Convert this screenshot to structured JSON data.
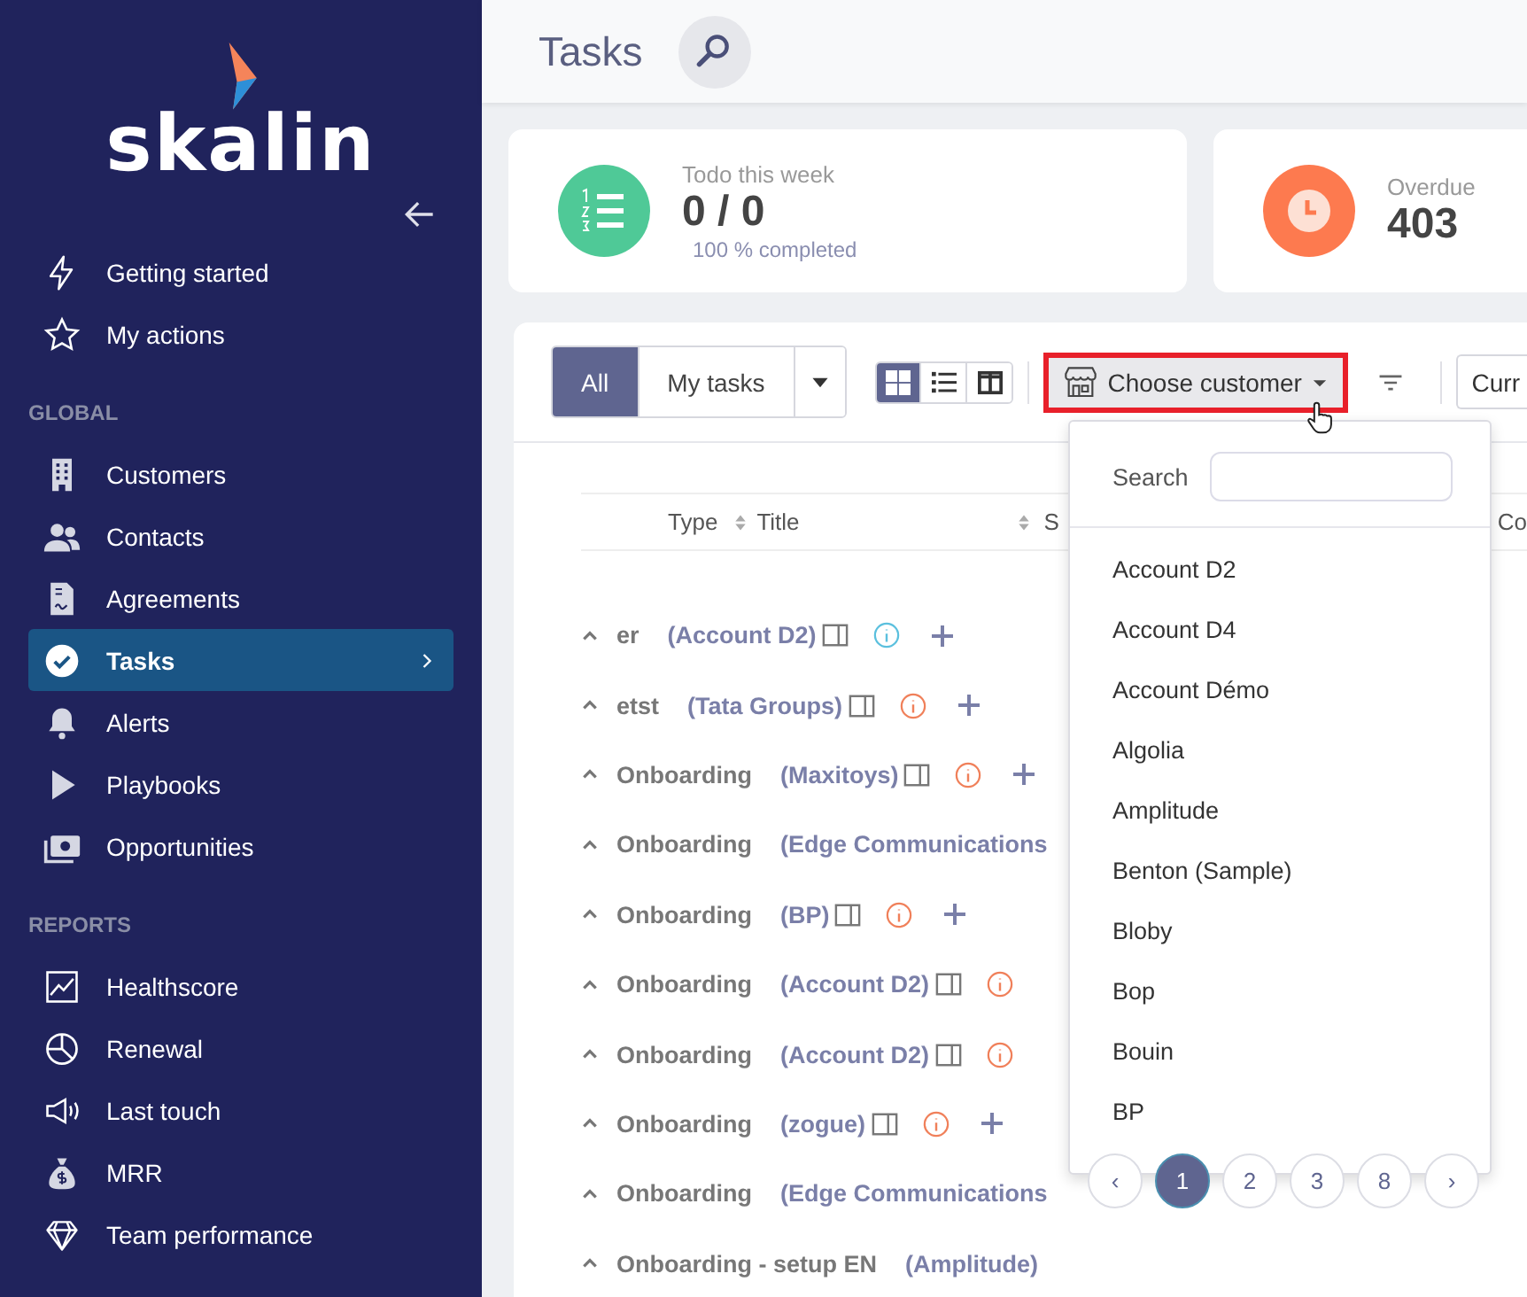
{
  "sidebar": {
    "logo": "skalin",
    "top_items": [
      {
        "label": "Getting started",
        "selected": false
      },
      {
        "label": "My actions",
        "selected": false
      }
    ],
    "sections": [
      {
        "title": "GLOBAL",
        "items": [
          {
            "label": "Customers",
            "selected": false
          },
          {
            "label": "Contacts",
            "selected": false
          },
          {
            "label": "Agreements",
            "selected": false
          },
          {
            "label": "Tasks",
            "selected": true
          },
          {
            "label": "Alerts",
            "selected": false
          },
          {
            "label": "Playbooks",
            "selected": false
          },
          {
            "label": "Opportunities",
            "selected": false
          }
        ]
      },
      {
        "title": "REPORTS",
        "items": [
          {
            "label": "Healthscore",
            "selected": false
          },
          {
            "label": "Renewal",
            "selected": false
          },
          {
            "label": "Last touch",
            "selected": false
          },
          {
            "label": "MRR",
            "selected": false
          },
          {
            "label": "Team performance",
            "selected": false
          }
        ]
      }
    ]
  },
  "header": {
    "title": "Tasks"
  },
  "stats": [
    {
      "kind": "todo",
      "label": "Todo this week",
      "value": "0 / 0",
      "sub": "100 % completed"
    },
    {
      "kind": "overdue",
      "label": "Overdue",
      "value": "403"
    }
  ],
  "toolbar": {
    "scope_tabs": [
      {
        "label": "All",
        "selected": true
      },
      {
        "label": "My tasks",
        "selected": false
      }
    ],
    "views": [
      {
        "kind": "grid",
        "selected": true
      },
      {
        "kind": "list",
        "selected": false
      },
      {
        "kind": "columns",
        "selected": false
      }
    ],
    "customer_button": "Choose customer",
    "period_button": "Curr"
  },
  "table": {
    "columns": [
      "Type",
      "Title",
      "S",
      "Co"
    ],
    "rows": [
      {
        "title": "er",
        "customer": "(Account D2)",
        "color": "#5bc0de",
        "add": true
      },
      {
        "title": "etst",
        "customer": "(Tata Groups)",
        "color": "#f0805a",
        "add": true
      },
      {
        "title": "Onboarding",
        "customer": "(Maxitoys)",
        "color": "#f0805a",
        "add": true
      },
      {
        "title": "Onboarding",
        "customer": "(Edge Communications"
      },
      {
        "title": "Onboarding",
        "customer": "(BP)",
        "color": "#f0805a",
        "add": true
      },
      {
        "title": "Onboarding",
        "customer": "(Account D2)",
        "color": "#f0805a",
        "add": false
      },
      {
        "title": "Onboarding",
        "customer": "(Account D2)",
        "color": "#f0805a",
        "add": false
      },
      {
        "title": "Onboarding",
        "customer": "(zogue)",
        "color": "#f0805a",
        "add": true
      },
      {
        "title": "Onboarding",
        "customer": "(Edge Communications"
      },
      {
        "title": "Onboarding - setup EN",
        "customer": "(Amplitude)"
      }
    ]
  },
  "customer_menu": {
    "search_label": "Search",
    "options": [
      "Account D2",
      "Account D4",
      "Account Démo",
      "Algolia",
      "Amplitude",
      "Benton (Sample)",
      "Bloby",
      "Bop",
      "Bouin",
      "BP"
    ],
    "pages": [
      {
        "label": "‹",
        "selected": false
      },
      {
        "label": "1",
        "selected": true
      },
      {
        "label": "2",
        "selected": false
      },
      {
        "label": "3",
        "selected": false
      },
      {
        "label": "8",
        "selected": false
      },
      {
        "label": "›",
        "selected": false
      }
    ]
  }
}
